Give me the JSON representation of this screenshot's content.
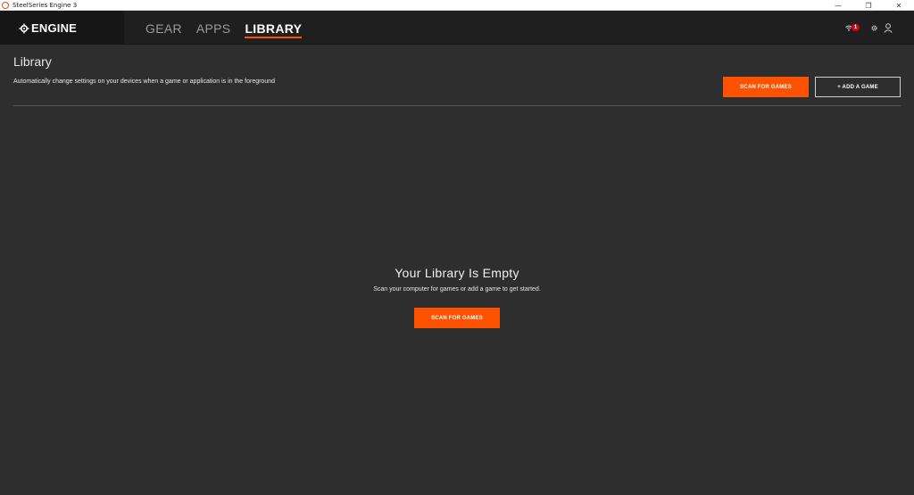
{
  "window": {
    "title": "SteelSeries Engine 3",
    "minimize_glyph": "—",
    "restore_glyph": "❐",
    "close_glyph": "✕"
  },
  "header": {
    "logo_text": "ENGINE",
    "tabs": [
      {
        "label": "GEAR",
        "active": false
      },
      {
        "label": "APPS",
        "active": false
      },
      {
        "label": "LIBRARY",
        "active": true
      }
    ],
    "notification_count": "1",
    "icons": [
      "wifi-icon",
      "gear-icon",
      "user-icon"
    ]
  },
  "library": {
    "title": "Library",
    "description": "Automatically change settings on your devices when a game or application is in the foreground",
    "scan_button": "SCAN FOR GAMES",
    "add_button": "+ ADD A GAME"
  },
  "empty_state": {
    "title": "Your Library Is Empty",
    "subtitle": "Scan your computer for games or add a game to get started.",
    "scan_button": "SCAN FOR GAMES"
  },
  "colors": {
    "accent": "#ff5200",
    "background": "#2e2e2e",
    "header": "#1f1f1f",
    "badge": "#d0021b"
  }
}
